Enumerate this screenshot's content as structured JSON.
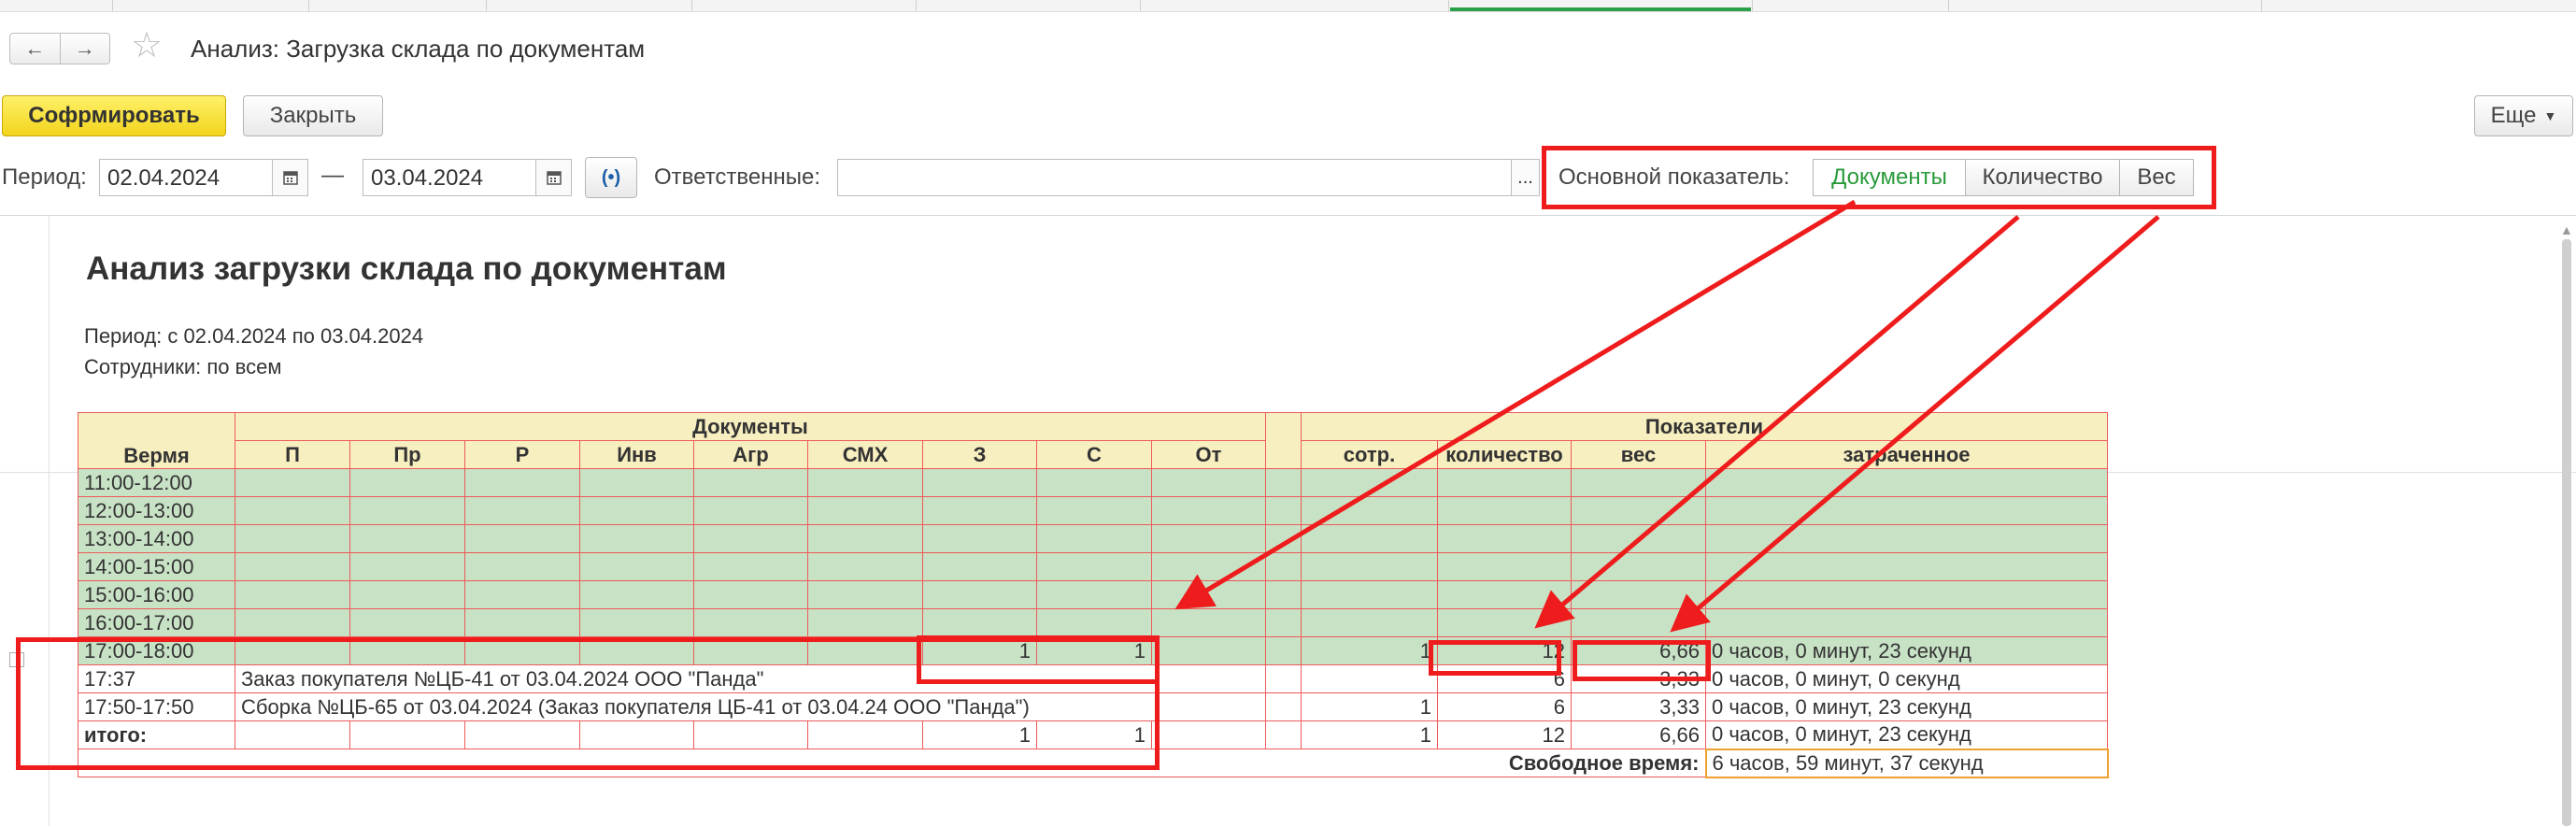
{
  "window": {
    "title": "Анализ: Загрузка склада по документам"
  },
  "toolbar": {
    "generate": "Софрмировать",
    "close": "Закрыть",
    "more": "Еще"
  },
  "filters": {
    "period_label": "Период:",
    "date_from": "02.04.2024",
    "dash": "—",
    "date_to": "03.04.2024",
    "responsible_label": "Ответственные:",
    "responsible_value": "",
    "ellipsis": "...",
    "indicator_label": "Основной показатель:",
    "indicators": [
      "Документы",
      "Количество",
      "Вес"
    ],
    "indicator_selected": "Документы"
  },
  "report": {
    "title": "Анализ загрузки склада по документам",
    "period": "Период: с 02.04.2024 по 03.04.2024",
    "employees": "Сотрудники: по всем",
    "header": {
      "time": "Вермя",
      "documents": "Документы",
      "indicators": "Показатели",
      "doc_cols": [
        "П",
        "Пр",
        "Р",
        "Инв",
        "Агр",
        "СМХ",
        "З",
        "С",
        "От"
      ],
      "ind_cols": [
        "сотр.",
        "количество",
        "вес",
        "затраченное"
      ]
    },
    "hours": [
      "11:00-12:00",
      "12:00-13:00",
      "13:00-14:00",
      "14:00-15:00",
      "15:00-16:00",
      "16:00-17:00"
    ],
    "row_1718": {
      "time": "17:00-18:00",
      "z": "1",
      "s": "1",
      "staff": "1",
      "qty": "12",
      "weight": "6,66",
      "spent": "0 часов, 0 минут, 23 секунд"
    },
    "row_order": {
      "time": "17:37",
      "desc": "Заказ покупателя №ЦБ-41 от 03.04.2024 ООО \"Панда\"",
      "qty": "6",
      "weight": "3,33",
      "spent": "0 часов, 0 минут, 0 секунд"
    },
    "row_assembly": {
      "time": "17:50-17:50",
      "desc": "Сборка №ЦБ-65 от 03.04.2024 (Заказ покупателя ЦБ-41 от 03.04.24 ООО \"Панда\")",
      "staff": "1",
      "qty": "6",
      "weight": "3,33",
      "spent": "0 часов, 0 минут, 23 секунд"
    },
    "row_total": {
      "label": "итого:",
      "z": "1",
      "s": "1",
      "staff": "1",
      "qty": "12",
      "weight": "6,66",
      "spent": "0 часов, 0 минут, 23 секунд"
    },
    "free_time": {
      "label": "Свободное время:",
      "value": "6 часов, 59 минут, 37 секунд"
    }
  }
}
